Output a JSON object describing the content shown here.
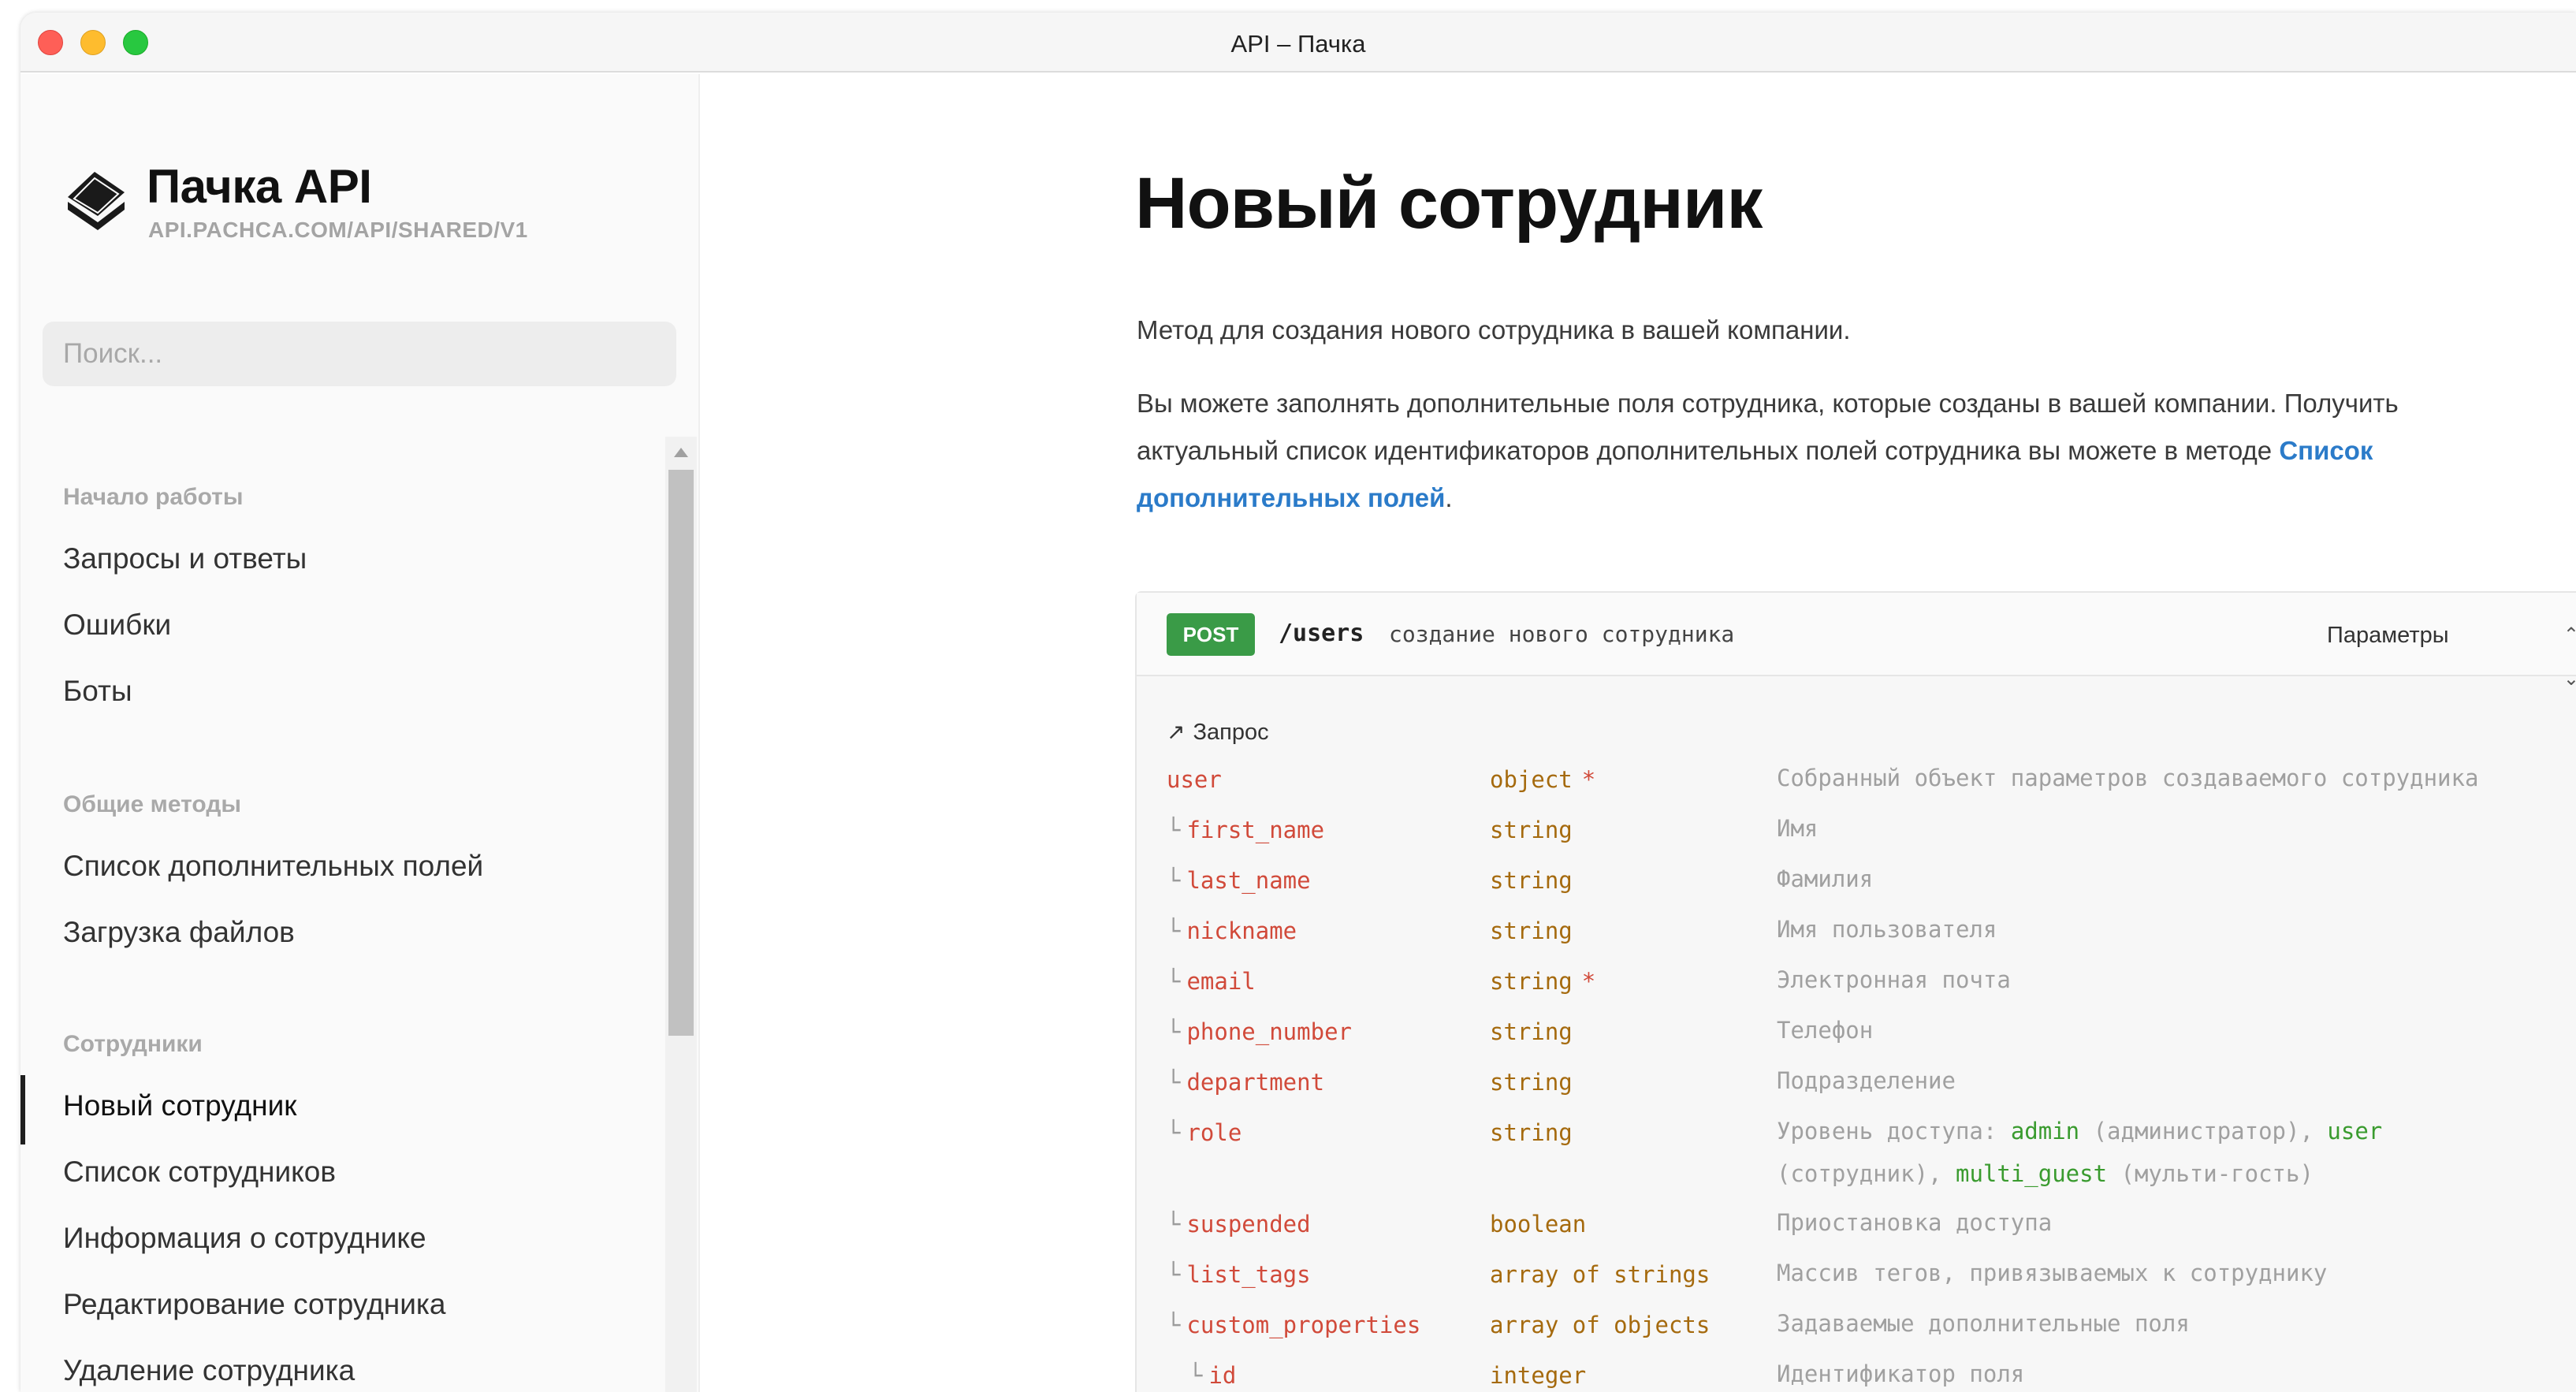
{
  "window": {
    "title": "API – Пачка"
  },
  "sidebar": {
    "brand_name": "Пачка API",
    "brand_url": "API.PACHCA.COM/API/SHARED/V1",
    "search_placeholder": "Поиск...",
    "sections": [
      {
        "title": "Начало работы",
        "items": [
          "Запросы и ответы",
          "Ошибки",
          "Боты"
        ]
      },
      {
        "title": "Общие методы",
        "items": [
          "Список дополнительных полей",
          "Загрузка файлов"
        ]
      },
      {
        "title": "Сотрудники",
        "items": [
          "Новый сотрудник",
          "Список сотрудников",
          "Информация о сотруднике",
          "Редактирование сотрудника",
          "Удаление сотрудника"
        ]
      }
    ],
    "active_item": "Новый сотрудник"
  },
  "main": {
    "title": "Новый сотрудник",
    "intro": "Метод для создания нового сотрудника в вашей компании.",
    "details_text": "Вы можете заполнять дополнительные поля сотрудника, которые созданы в вашей компании. Получить актуальный список идентификаторов дополнительных полей сотрудника вы можете в методе ",
    "details_link": "Список дополнительных полей",
    "details_end": ".",
    "endpoint": {
      "method": "POST",
      "path": "/users",
      "description": "создание нового сотрудника",
      "params_select": "Параметры",
      "request_label": "Запрос",
      "params": [
        {
          "name": "user",
          "type": "object",
          "required": "*",
          "desc": "Собранный объект параметров создаваемого сотрудника"
        },
        {
          "name": "first_name",
          "type": "string",
          "required": "",
          "desc": "Имя"
        },
        {
          "name": "last_name",
          "type": "string",
          "required": "",
          "desc": "Фамилия"
        },
        {
          "name": "nickname",
          "type": "string",
          "required": "",
          "desc": "Имя пользователя"
        },
        {
          "name": "email",
          "type": "string",
          "required": "*",
          "desc": "Электронная почта"
        },
        {
          "name": "phone_number",
          "type": "string",
          "required": "",
          "desc": "Телефон"
        },
        {
          "name": "department",
          "type": "string",
          "required": "",
          "desc": "Подразделение"
        },
        {
          "name": "role",
          "type": "string",
          "required": "",
          "desc_parts": [
            "Уровень доступа: ",
            "admin",
            " (администратор), ",
            "user",
            " (сотрудник), ",
            "multi_guest",
            " (мульти-гость)"
          ]
        },
        {
          "name": "suspended",
          "type": "boolean",
          "required": "",
          "desc": "Приостановка доступа"
        },
        {
          "name": "list_tags",
          "type": "array of strings",
          "required": "",
          "desc": "Массив тегов, привязываемых к сотруднику"
        },
        {
          "name": "custom_properties",
          "type": "array of objects",
          "required": "",
          "desc": "Задаваемые дополнительные поля"
        },
        {
          "name": "id",
          "type": "integer",
          "required": "",
          "desc": "Идентификатор поля"
        }
      ]
    }
  },
  "colors": {
    "post_badge": "#3a9b47",
    "param_name": "#d14a3a",
    "param_type": "#a56a0e",
    "link": "#2b7bc9"
  },
  "icons": {
    "logo": "book-stack-icon",
    "request_arrow": "arrow-up-right-icon",
    "select_arrows": "updown-chevron-icon"
  }
}
